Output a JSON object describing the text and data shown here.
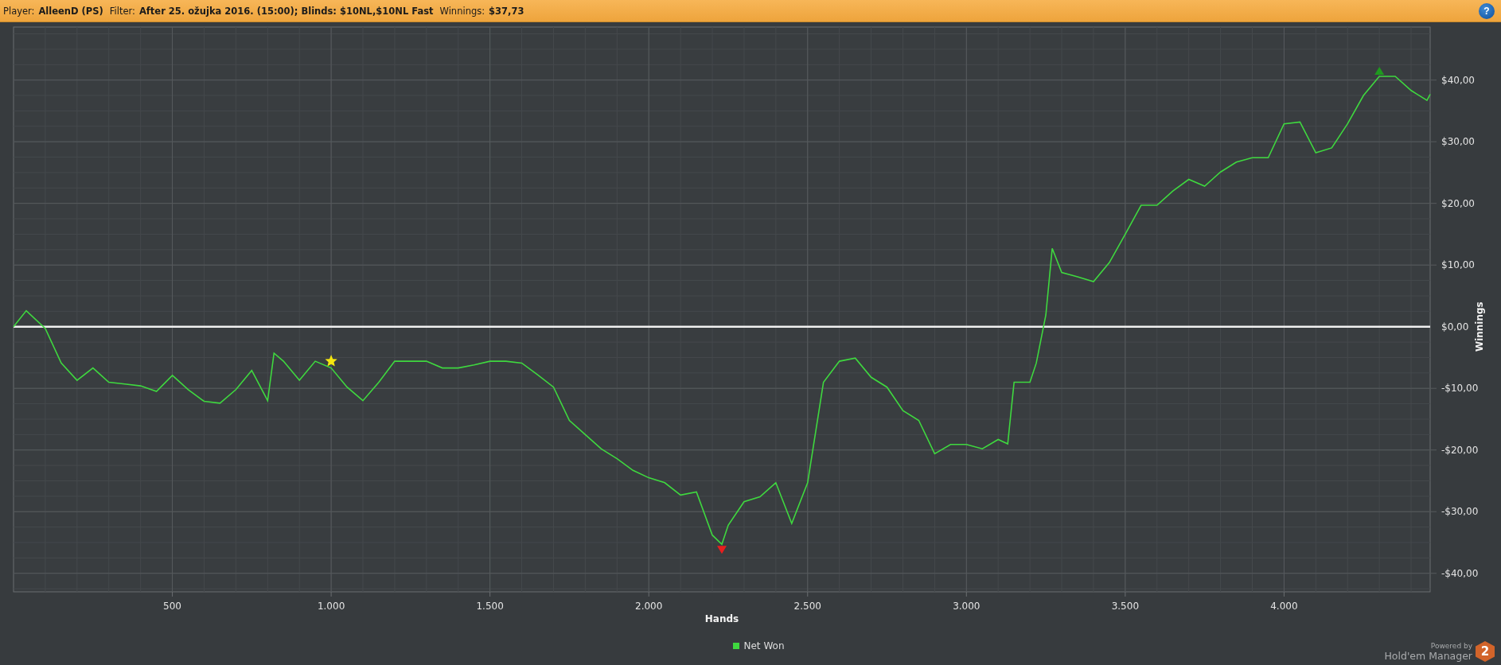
{
  "header": {
    "fields": [
      {
        "label": "Player:",
        "value": "AlleenD (PS)"
      },
      {
        "label": "Filter:",
        "value": "After 25. ožujka 2016. (15:00); Blinds: $10NL,$10NL Fast"
      },
      {
        "label": "Winnings:",
        "value": "$37,73"
      }
    ],
    "help": "?"
  },
  "chart_data": {
    "type": "line",
    "xlabel": "Hands",
    "ylabel": "Winnings",
    "x": [
      0,
      40,
      100,
      150,
      200,
      250,
      300,
      350,
      400,
      450,
      500,
      550,
      600,
      650,
      700,
      750,
      800,
      820,
      850,
      900,
      950,
      1000,
      1050,
      1100,
      1150,
      1200,
      1250,
      1300,
      1350,
      1400,
      1450,
      1500,
      1550,
      1600,
      1650,
      1700,
      1750,
      1800,
      1850,
      1900,
      1950,
      2000,
      2050,
      2100,
      2150,
      2200,
      2230,
      2250,
      2300,
      2350,
      2400,
      2450,
      2500,
      2550,
      2600,
      2650,
      2700,
      2750,
      2800,
      2850,
      2900,
      2950,
      3000,
      3050,
      3100,
      3130,
      3150,
      3200,
      3220,
      3250,
      3270,
      3300,
      3350,
      3400,
      3450,
      3500,
      3550,
      3600,
      3650,
      3700,
      3750,
      3800,
      3850,
      3900,
      3950,
      4000,
      4050,
      4100,
      4150,
      4200,
      4250,
      4300,
      4350,
      4400,
      4450,
      4460
    ],
    "series": [
      {
        "name": "Net Won",
        "color": "#3fd83f",
        "values": [
          0,
          2.6,
          -0.3,
          -5.9,
          -8.7,
          -6.7,
          -9,
          -9.3,
          -9.6,
          -10.5,
          -7.9,
          -10.2,
          -12.1,
          -12.4,
          -10.2,
          -7.1,
          -12,
          -4.3,
          -5.6,
          -8.7,
          -5.6,
          -6.7,
          -9.8,
          -12,
          -9,
          -5.6,
          -5.6,
          -5.6,
          -6.7,
          -6.7,
          -6.2,
          -5.6,
          -5.6,
          -5.9,
          -7.8,
          -9.8,
          -15.2,
          -17.5,
          -19.8,
          -21.4,
          -23.3,
          -24.5,
          -25.3,
          -27.3,
          -26.8,
          -33.8,
          -35.3,
          -32.2,
          -28.4,
          -27.6,
          -25.3,
          -31.9,
          -25.3,
          -9,
          -5.6,
          -5.1,
          -8.2,
          -9.8,
          -13.6,
          -15.2,
          -20.6,
          -19.1,
          -19.1,
          -19.8,
          -18.3,
          -19,
          -9,
          -9,
          -5.9,
          1.9,
          12.7,
          8.8,
          8.1,
          7.3,
          10.4,
          15,
          19.7,
          19.7,
          22,
          23.9,
          22.8,
          25.1,
          26.7,
          27.4,
          27.4,
          32.9,
          33.2,
          28.2,
          29,
          32.9,
          37.5,
          40.6,
          40.6,
          38.3,
          36.7,
          37.7
        ]
      }
    ],
    "xlim": [
      0,
      4460
    ],
    "ylim": [
      -43,
      48.6
    ],
    "xticks": [
      {
        "value": 500,
        "label": "500"
      },
      {
        "value": 1000,
        "label": "1.000"
      },
      {
        "value": 1500,
        "label": "1.500"
      },
      {
        "value": 2000,
        "label": "2.000"
      },
      {
        "value": 2500,
        "label": "2.500"
      },
      {
        "value": 3000,
        "label": "3.000"
      },
      {
        "value": 3500,
        "label": "3.500"
      },
      {
        "value": 4000,
        "label": "4.000"
      }
    ],
    "yticks": [
      {
        "value": 40,
        "label": "$40,00"
      },
      {
        "value": 30,
        "label": "$30,00"
      },
      {
        "value": 20,
        "label": "$20,00"
      },
      {
        "value": 10,
        "label": "$10,00"
      },
      {
        "value": 0,
        "label": "$0,00"
      },
      {
        "value": -10,
        "label": "-$10,00"
      },
      {
        "value": -20,
        "label": "-$20,00"
      },
      {
        "value": -30,
        "label": "-$30,00"
      },
      {
        "value": -40,
        "label": "-$40,00"
      }
    ],
    "grid": true
  },
  "markers": [
    {
      "kind": "star"
    },
    {
      "kind": "max"
    },
    {
      "kind": "min"
    }
  ],
  "branding": {
    "powered_by": "Powered by",
    "product": "Hold'em Manager",
    "badge": "2"
  }
}
